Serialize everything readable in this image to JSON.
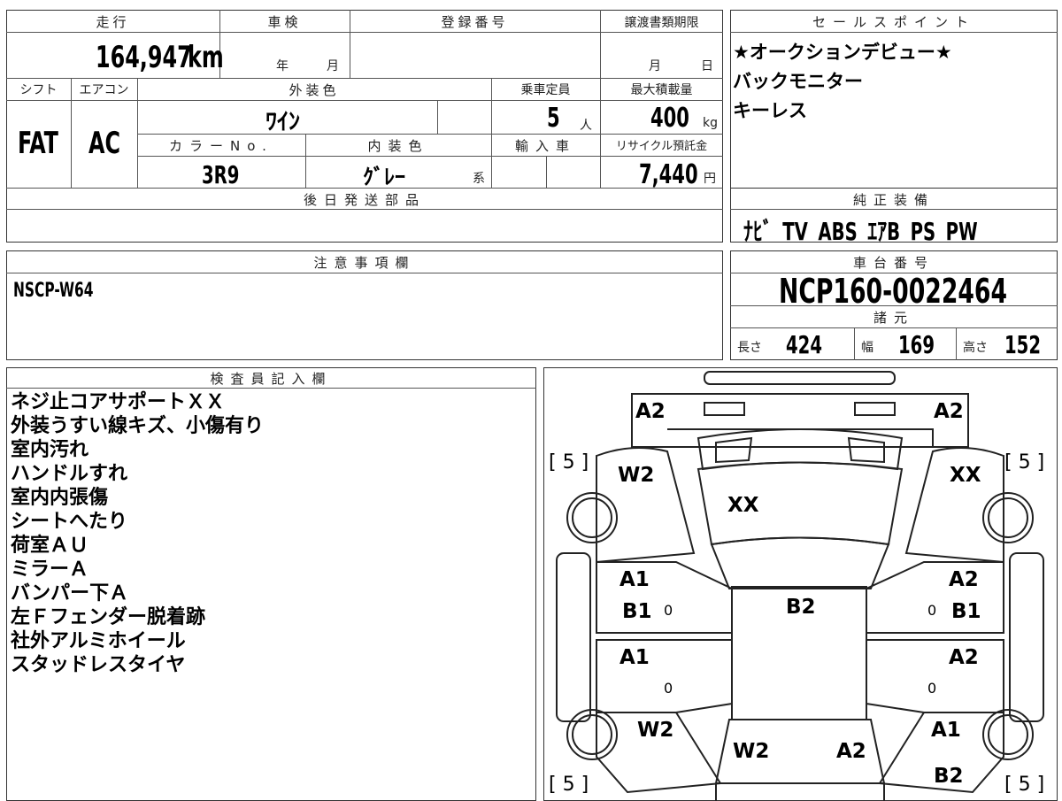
{
  "headers": {
    "mileage": "走行",
    "inspection": "車検",
    "registration_no": "登録番号",
    "transfer_deadline": "譲渡書類期限",
    "shift": "シフト",
    "aircon": "エアコン",
    "exterior_color": "外装色",
    "capacity": "乗車定員",
    "max_load": "最大積載量",
    "color_no": "カラーNo.",
    "interior_color": "内装色",
    "import": "輸入車",
    "recycle_fee": "リサイクル預託金",
    "later_parts": "後日発送部品",
    "notes": "注意事項欄",
    "sales_points": "セールスポイント",
    "genuine_equipment": "純正装備",
    "chassis_no": "車台番号",
    "specs": "諸元",
    "inspector": "検査員記入欄"
  },
  "vehicle": {
    "mileage_value": "164,947",
    "mileage_unit": "km",
    "inspection_year_unit": "年",
    "inspection_month_unit": "月",
    "deadline_month_unit": "月",
    "deadline_day_unit": "日",
    "shift": "FAT",
    "aircon": "AC",
    "exterior_color": "ﾜｲﾝ",
    "capacity_value": "5",
    "capacity_unit": "人",
    "max_load_value": "400",
    "max_load_unit": "kg",
    "color_no": "3R9",
    "interior_color": "ｸﾞﾚｰ",
    "interior_suffix": "系",
    "recycle_value": "7,440",
    "recycle_unit": "円",
    "notes_text": "NSCP-W64",
    "chassis_no": "NCP160-0022464",
    "length_label": "長さ",
    "length_value": "424",
    "width_label": "幅",
    "width_value": "169",
    "height_label": "高さ",
    "height_value": "152"
  },
  "sales_points": [
    "★オークションデビュー★",
    "バックモニター",
    "キーレス"
  ],
  "genuine_equipment": "ﾅﾋﾞ TV ABS ｴｱB PS PW",
  "inspector_notes": [
    "ネジ止コアサポートＸＸ",
    "外装うすい線キズ、小傷有り",
    "室内汚れ",
    "ハンドルすれ",
    "室内内張傷",
    "シートへたり",
    "荷室ＡＵ",
    "ミラーＡ",
    "バンパー下Ａ",
    "左Ｆフェンダー脱着跡",
    "社外アルミホイール",
    "スタッドレスタイヤ"
  ],
  "diagram": {
    "front_left": "A2",
    "front_right": "A2",
    "tire_fl": "[ 5 ]",
    "tire_fr": "[ 5 ]",
    "tire_rl": "[ 5 ]",
    "tire_rr": "[ 5 ]",
    "fender_fl": "W2",
    "fender_fr": "XX",
    "hood": "XX",
    "door_fl": "A1",
    "sill_fl": "B1",
    "door_fl_mark": "0",
    "door_fr": "A2",
    "sill_fr": "B1",
    "door_fr_mark": "0",
    "roof": "B2",
    "door_rl": "A1",
    "door_rl_mark": "0",
    "door_rr": "A2",
    "door_rr_mark": "0",
    "fender_rl": "W2",
    "fender_rr": "A1",
    "rear_left": "W2",
    "rear_right": "A2",
    "rear_quarter_r": "B2"
  }
}
